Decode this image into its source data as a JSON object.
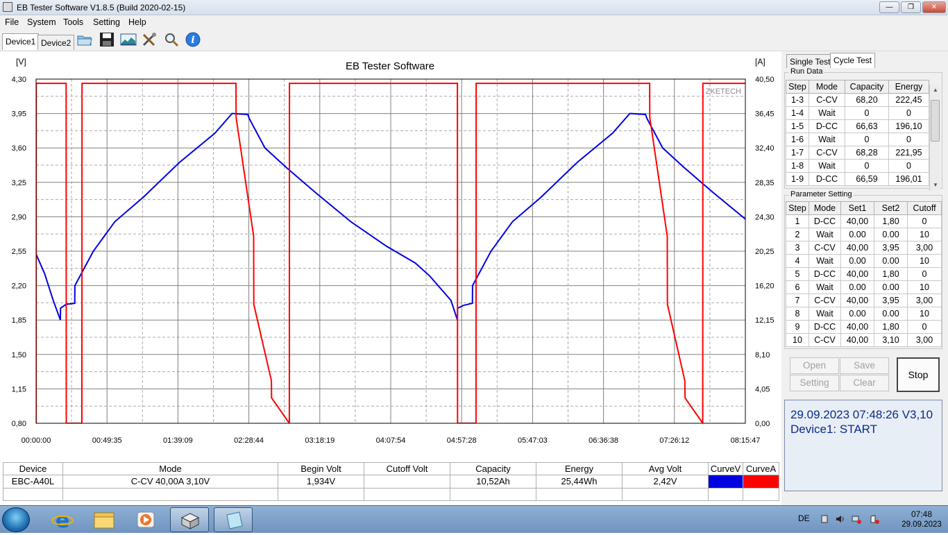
{
  "window": {
    "title": "EB Tester Software V1.8.5 (Build 2020-02-15)"
  },
  "menu": [
    "File",
    "System",
    "Tools",
    "Setting",
    "Help"
  ],
  "device_tabs": [
    "Device1",
    "Device2"
  ],
  "toolbar_icons": [
    "open-folder-icon",
    "save-icon",
    "chart-image-icon",
    "tools-icon",
    "zoom-icon",
    "info-icon"
  ],
  "colors": {
    "voltage_curve": "#0000e0",
    "current_curve": "#ff0000",
    "grid": "#808080",
    "status_text": "#0a2a8c"
  },
  "chart_data": {
    "type": "line",
    "title": "EB Tester Software",
    "watermark": "ZKETECH",
    "y_left_unit": "[V]",
    "y_right_unit": "[A]",
    "x_ticks": [
      "00:00:00",
      "00:49:35",
      "01:39:09",
      "02:28:44",
      "03:18:19",
      "04:07:54",
      "04:57:28",
      "05:47:03",
      "06:36:38",
      "07:26:12",
      "08:15:47"
    ],
    "y_left_ticks": [
      "4,30",
      "3,95",
      "3,60",
      "3,25",
      "2,90",
      "2,55",
      "2,20",
      "1,85",
      "1,50",
      "1,15",
      "0,80"
    ],
    "y_right_ticks": [
      "40,50",
      "36,45",
      "32,40",
      "28,35",
      "24,30",
      "20,25",
      "16,20",
      "12,15",
      "8,10",
      "4,05",
      "0,00"
    ],
    "ylim_left": [
      0.8,
      4.3
    ],
    "ylim_right": [
      0,
      40.5
    ],
    "x_range_minutes": [
      0,
      495.78
    ],
    "grid": true,
    "series": [
      {
        "axis": "left",
        "x_minutes": [
          0,
          6,
          12,
          17,
          17.1,
          21,
          27,
          27.1,
          40,
          55,
          75,
          100,
          125,
          137,
          138,
          148,
          149,
          160,
          175,
          195,
          220,
          245,
          265,
          275,
          290,
          294.5,
          294.6,
          299,
          305,
          305.1,
          318,
          333,
          353,
          378,
          403,
          415,
          416,
          426,
          427,
          438,
          453,
          473,
          498,
          523,
          543,
          553,
          568,
          572.5,
          572.6,
          576,
          590,
          603
        ],
        "values": [
          2.52,
          2.32,
          2.05,
          1.85,
          1.97,
          2.01,
          2.02,
          2.2,
          2.55,
          2.85,
          3.1,
          3.45,
          3.75,
          3.95,
          3.95,
          3.94,
          3.9,
          3.6,
          3.4,
          3.15,
          2.85,
          2.6,
          2.43,
          2.3,
          2.05,
          1.85,
          1.97,
          2.0,
          2.02,
          2.2,
          2.55,
          2.85,
          3.1,
          3.45,
          3.75,
          3.95,
          3.95,
          3.94,
          3.9,
          3.6,
          3.4,
          3.15,
          2.85,
          2.6,
          2.43,
          2.3,
          2.05,
          1.85,
          2.12,
          2.3,
          2.55,
          2.7
        ]
      },
      {
        "axis": "right",
        "x_minutes": [
          0,
          0.1,
          21,
          21.1,
          32,
          32.1,
          139.7,
          139.8,
          152.1,
          152.2,
          164.5,
          164.6,
          177,
          177.1,
          294.5,
          294.6,
          307.5,
          307.6,
          428.9,
          429,
          441.2,
          441.3,
          453.5,
          453.6,
          466,
          466.1,
          578.9,
          579,
          603
        ],
        "values": [
          0,
          40.0,
          40.0,
          0,
          0,
          40.0,
          40.0,
          36.0,
          22.0,
          14.0,
          5.0,
          3.0,
          0,
          40.0,
          40.0,
          0,
          0,
          40.0,
          40.0,
          36.0,
          22.0,
          14.0,
          5.0,
          3.0,
          0,
          40.0,
          40.0,
          0,
          0
        ]
      }
    ]
  },
  "results": {
    "headers": [
      "Device",
      "Mode",
      "Begin Volt",
      "Cutoff Volt",
      "Capacity",
      "Energy",
      "Avg Volt",
      "CurveV",
      "CurveA"
    ],
    "row": [
      "EBC-A40L",
      "C-CV  40,00A  3,10V",
      "1,934V",
      "",
      "10,52Ah",
      "25,44Wh",
      "2,42V"
    ]
  },
  "right_tabs": [
    "Single Test",
    "Cycle Test"
  ],
  "run_data": {
    "label": "Run Data",
    "headers": [
      "Step",
      "Mode",
      "Capacity",
      "Energy"
    ],
    "rows": [
      [
        "1-3",
        "C-CV",
        "68,20",
        "222,45"
      ],
      [
        "1-4",
        "Wait",
        "0",
        "0"
      ],
      [
        "1-5",
        "D-CC",
        "66,63",
        "196,10"
      ],
      [
        "1-6",
        "Wait",
        "0",
        "0"
      ],
      [
        "1-7",
        "C-CV",
        "68,28",
        "221,95"
      ],
      [
        "1-8",
        "Wait",
        "0",
        "0"
      ],
      [
        "1-9",
        "D-CC",
        "66,59",
        "196,01"
      ]
    ]
  },
  "parameter_setting": {
    "label": "Parameter Setting",
    "headers": [
      "Step",
      "Mode",
      "Set1",
      "Set2",
      "Cutoff"
    ],
    "rows": [
      [
        "1",
        "D-CC",
        "40,00",
        "1,80",
        "0"
      ],
      [
        "2",
        "Wait",
        "0.00",
        "0.00",
        "10"
      ],
      [
        "3",
        "C-CV",
        "40,00",
        "3,95",
        "3,00"
      ],
      [
        "4",
        "Wait",
        "0.00",
        "0.00",
        "10"
      ],
      [
        "5",
        "D-CC",
        "40,00",
        "1,80",
        "0"
      ],
      [
        "6",
        "Wait",
        "0.00",
        "0.00",
        "10"
      ],
      [
        "7",
        "C-CV",
        "40,00",
        "3,95",
        "3,00"
      ],
      [
        "8",
        "Wait",
        "0.00",
        "0.00",
        "10"
      ],
      [
        "9",
        "D-CC",
        "40,00",
        "1,80",
        "0"
      ],
      [
        "10",
        "C-CV",
        "40,00",
        "3,10",
        "3,00"
      ]
    ]
  },
  "buttons": {
    "open": "Open",
    "save": "Save",
    "setting": "Setting",
    "clear": "Clear",
    "stop": "Stop"
  },
  "status": {
    "line1": "29.09.2023 07:48:26  V3,10",
    "line2": "Device1: START"
  },
  "taskbar": {
    "language": "DE",
    "time": "07:48",
    "date": "29.09.2023"
  }
}
